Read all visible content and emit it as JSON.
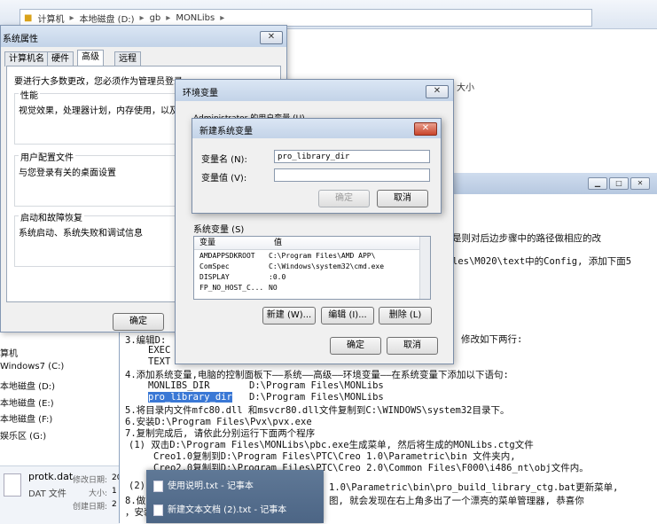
{
  "explorer": {
    "breadcrumb": [
      "计算机",
      "本地磁盘 (D:)",
      "gb",
      "MONLibs"
    ],
    "column_size": "大小",
    "nav_items": [
      "算机",
      "Windows7 (C:)",
      "本地磁盘 (D:)",
      "本地磁盘 (E:)",
      "本地磁盘 (F:)",
      "娱乐区 (G:)"
    ],
    "file": {
      "name": "protk.dat",
      "type": "DAT 文件",
      "modified_label": "修改日期:",
      "modified_value": "20",
      "size_label": "大小:",
      "size_value": "1",
      "created_label": "创建日期:",
      "created_value": "2"
    }
  },
  "system_properties": {
    "title": "系统属性",
    "tabs": [
      "计算机名",
      "硬件",
      "高级",
      "远程"
    ],
    "admin_note": "要进行大多数更改，您必须作为管理员登录",
    "perf_title": "性能",
    "perf_text": "视觉效果，处理器计划，内存使用，以及",
    "profile_title": "用户配置文件",
    "profile_text": "与您登录有关的桌面设置",
    "startup_title": "启动和故障恢复",
    "startup_text": "系统启动、系统失败和调试信息",
    "ok_label": "确定"
  },
  "env_vars": {
    "title": "环境变量",
    "user_vars_label": "Administrator 的用户变量 (U)",
    "system_vars_label": "系统变量 (S)",
    "table_headers": [
      "变量",
      "值"
    ],
    "rows": [
      {
        "name": "AMDAPPSDKROOT",
        "value": "C:\\Program Files\\AMD APP\\"
      },
      {
        "name": "ComSpec",
        "value": "C:\\Windows\\system32\\cmd.exe"
      },
      {
        "name": "DISPLAY",
        "value": ":0.0"
      },
      {
        "name": "FP_NO_HOST_C...",
        "value": "NO"
      }
    ],
    "new_label": "新建 (W)...",
    "edit_label": "编辑 (I)...",
    "delete_label": "删除 (L)",
    "ok_label": "确定",
    "cancel_label": "取消"
  },
  "new_var": {
    "title": "新建系统变量",
    "name_label": "变量名 (N):",
    "name_value": "pro_library_dir",
    "value_label": "变量值 (V):",
    "value_value": "",
    "ok_label": "确定",
    "cancel_label": "取消"
  },
  "notepad": {
    "line_a": "是则对后边步骤中的路径做相应的改",
    "line_b": "les\\M020\\text中的Config, 添加下面5",
    "line_c": "修改如下两行:",
    "line_edit": "3.编辑D:",
    "line_exec": "EXEC",
    "line_text": "TEXT",
    "line4": "4.添加系统变量,电脑的控制面板下——系统——高级——环境变量——在系统变量下添加以下语句:",
    "line4a_name": "MONLIBS_DIR",
    "line4a_value": "D:\\Program Files\\MONLibs",
    "line4b_name": "pro_library_dir",
    "line4b_value": "D:\\Program Files\\MONLibs",
    "line5": "5.将目录内文件mfc80.dll 和msvcr80.dll文件复制到C:\\WINDOWS\\system32目录下。",
    "line6": "6.安装D:\\Program Files\\Pvx\\pvx.exe",
    "line7": "7.复制完成后, 请依此分别运行下面两个程序",
    "line7_1": "(1) 双击D:\\Program Files\\MONLibs\\pbc.exe生成菜单, 然后将生成的MONLibs.ctg文件",
    "line7_1a": "Creo1.0复制到D:\\Program Files\\PTC\\Creo 1.0\\Parametric\\bin 文件夹内,",
    "line7_1b": "Creo2.0复制到D:\\Program Files\\PTC\\Creo 2.0\\Common Files\\F000\\i486_nt\\obj文件内。",
    "line7_2": "(2)",
    "line7_2b": "1.0\\Parametric\\bin\\pro_build_library_ctg.bat更新菜单,",
    "line8": "8.做",
    "line8b": "图, 就会发现在右上角多出了一个漂亮的菜单管理器, 恭喜你",
    "line8c": "，安装"
  },
  "taskbar_popup": {
    "items": [
      "使用说明.txt - 记事本",
      "新建文本文档 (2).txt - 记事本"
    ]
  }
}
